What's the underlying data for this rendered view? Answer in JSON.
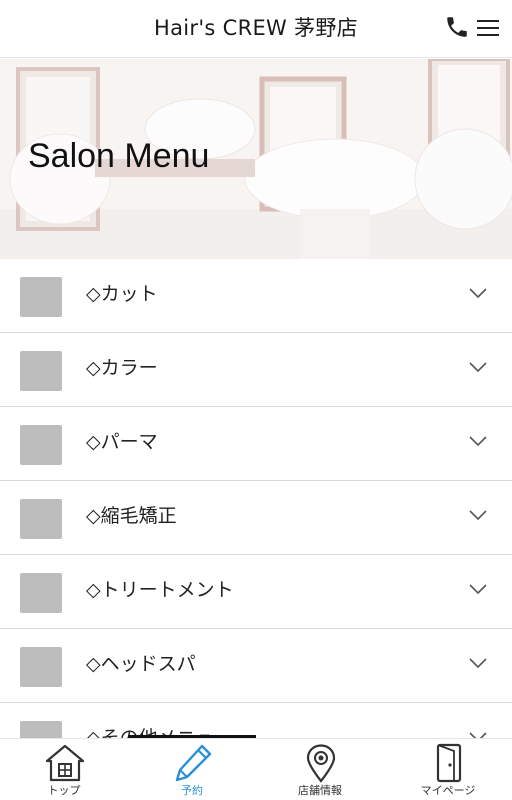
{
  "header": {
    "title": "Hair's CREW 茅野店"
  },
  "hero": {
    "title": "Salon Menu"
  },
  "menu": {
    "items": [
      {
        "label": "◇カット"
      },
      {
        "label": "◇カラー"
      },
      {
        "label": "◇パーマ"
      },
      {
        "label": "◇縮毛矯正"
      },
      {
        "label": "◇トリートメント"
      },
      {
        "label": "◇ヘッドスパ"
      },
      {
        "label": "◇その他メニュー"
      }
    ]
  },
  "tabbar": {
    "tabs": [
      {
        "label": "トップ",
        "icon": "home-icon"
      },
      {
        "label": "予約",
        "icon": "pencil-icon",
        "active": true
      },
      {
        "label": "店舗情報",
        "icon": "map-pin-icon"
      },
      {
        "label": "マイページ",
        "icon": "door-icon"
      }
    ]
  },
  "colors": {
    "accent": "#2a8fd6",
    "thumb": "#bdbdbd",
    "divider": "#d8d8d8"
  }
}
